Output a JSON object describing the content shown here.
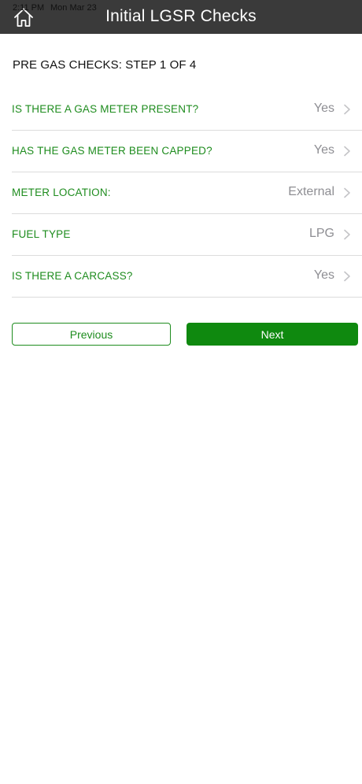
{
  "status_bar": {
    "time": "2:11 PM",
    "date": "Mon Mar 23"
  },
  "header": {
    "title": "Initial LGSR Checks",
    "home_icon": "home-icon"
  },
  "step": {
    "title": "PRE GAS CHECKS: STEP 1 OF 4"
  },
  "questions": [
    {
      "label": "IS THERE A GAS METER PRESENT?",
      "value": "Yes"
    },
    {
      "label": "HAS THE GAS METER BEEN CAPPED?",
      "value": "Yes"
    },
    {
      "label": "METER LOCATION:",
      "value": "External"
    },
    {
      "label": "FUEL TYPE",
      "value": "LPG"
    },
    {
      "label": "IS THERE A CARCASS?",
      "value": "Yes"
    }
  ],
  "buttons": {
    "previous": "Previous",
    "next": "Next"
  },
  "colors": {
    "header_bg": "#3a3a3a",
    "accent_green": "#1e8c1e",
    "next_button_green": "#0f890f",
    "value_gray": "#8e8e93"
  }
}
